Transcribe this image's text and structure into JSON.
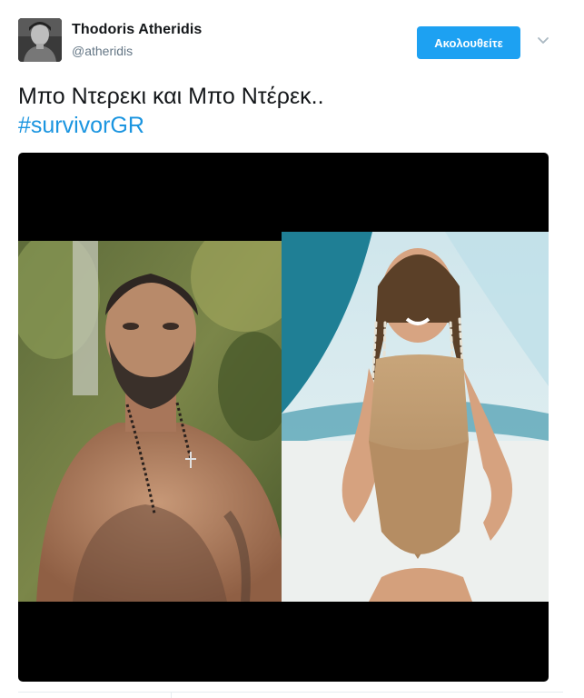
{
  "author": {
    "name": "Thodoris Atheridis",
    "handle": "@atheridis"
  },
  "follow_button": {
    "label": "Ακολουθείτε"
  },
  "menu": {
    "icon": "chevron-down-icon"
  },
  "tweet": {
    "text": "Μπο Ντερεκι και Μπο Ντέρεκ..",
    "hashtag": "#survivorGR"
  },
  "colors": {
    "accent": "#1da1f2",
    "link": "#1b95e0",
    "handle": "#657786",
    "text": "#14171a"
  }
}
